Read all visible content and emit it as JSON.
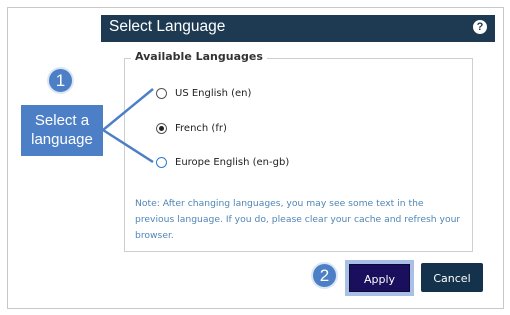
{
  "dialog": {
    "title": "Select Language",
    "help_icon": "?",
    "section_legend": "Available Languages",
    "options": [
      {
        "label": "US English (en)",
        "checked": false
      },
      {
        "label": "French (fr)",
        "checked": true
      },
      {
        "label": "Europe English (en-gb)",
        "checked": false
      }
    ],
    "note": "Note: After changing languages, you may see some text in the previous language. If you do, please clear your cache and refresh your browser.",
    "apply_label": "Apply",
    "cancel_label": "Cancel"
  },
  "callouts": {
    "step1_number": "1",
    "step1_text": "Select a language",
    "step2_number": "2"
  },
  "colors": {
    "titlebar": "#1d3a52",
    "callout": "#4d7fc6",
    "apply": "#1a0f5c",
    "cancel": "#14324c",
    "note": "#4f86b6"
  }
}
